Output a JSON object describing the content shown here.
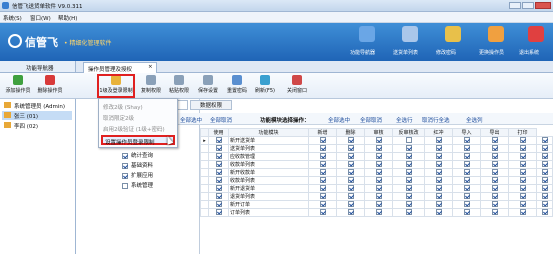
{
  "window": {
    "title": "信管飞送货单软件 V9.0.311"
  },
  "menu": [
    "系统(S)",
    "窗口(W)",
    "帮助(H)"
  ],
  "banner": {
    "logo": "信管飞",
    "slogan": "• 精细化管理软件",
    "buttons": [
      {
        "label": "功能导航器",
        "icon": "navigator-icon",
        "color": "#6aa6e6"
      },
      {
        "label": "送货单列表",
        "icon": "list-icon",
        "color": "#a9c6ea"
      },
      {
        "label": "修改密码",
        "icon": "lock-icon",
        "color": "#e8c04a"
      },
      {
        "label": "更换操作员",
        "icon": "user-icon",
        "color": "#f0a040"
      },
      {
        "label": "退出系统",
        "icon": "power-icon",
        "color": "#e04040"
      }
    ]
  },
  "nav": {
    "title": "功能导航器"
  },
  "tabs": [
    {
      "label": "操作员管理及授权",
      "close": "×"
    }
  ],
  "toolbar": [
    {
      "label": "添加操作员",
      "color": "#3fa03f"
    },
    {
      "label": "删除操作员",
      "color": "#d83a3a"
    },
    {
      "label": "1级及登录限制",
      "color": "#e8b23a"
    },
    {
      "label": "复制权限",
      "color": "#8aa0b8"
    },
    {
      "label": "粘贴权限",
      "color": "#8aa0b8"
    },
    {
      "label": "保存设置",
      "color": "#8aa0b8"
    },
    {
      "label": "重置密码",
      "color": "#5a8fd0"
    },
    {
      "label": "刷新(F5)",
      "color": "#3aa0d0"
    },
    {
      "label": "关闭窗口",
      "color": "#d04848"
    }
  ],
  "dropdown": {
    "items": [
      "修改2级 (Shay)",
      "取消限定2级",
      "启用2级验证 (1级+密码)",
      "设置操作员登录限制"
    ],
    "selected": 3
  },
  "users": [
    {
      "name": "系统管理员 (Admin)",
      "selected": false
    },
    {
      "name": "张三 (01)",
      "selected": true
    },
    {
      "name": "李四 (02)",
      "selected": false
    }
  ],
  "subtabs": [
    "操作权限",
    "数据权限"
  ],
  "modules": [
    {
      "label": "统计查询",
      "checked": true
    },
    {
      "label": "基础资料",
      "checked": true
    },
    {
      "label": "扩展应用",
      "checked": true
    },
    {
      "label": "系统管理",
      "checked": false
    }
  ],
  "perm_bar": {
    "select_all_left": "全部选中",
    "clear_all_left": "全部取消",
    "title": "功能模块选择操作：",
    "select_all": "全部选中",
    "clear_all": "全部取消",
    "select_row": "全选行",
    "clear_row": "取消行全选",
    "select_col": "全选列"
  },
  "grid": {
    "columns": [
      "使用",
      "功能模块",
      "新增",
      "删除",
      "审核",
      "反审核改",
      "红冲",
      "导入",
      "导出",
      "打印"
    ],
    "rows": [
      {
        "name": "新开送货单",
        "cells": [
          1,
          1,
          1,
          1,
          0,
          1,
          1,
          1,
          1,
          1
        ]
      },
      {
        "name": "送货单列表",
        "cells": [
          1,
          1,
          1,
          1,
          1,
          1,
          1,
          1,
          1,
          1
        ]
      },
      {
        "name": "应收款管理",
        "cells": [
          1,
          1,
          1,
          1,
          1,
          1,
          1,
          1,
          1,
          1
        ]
      },
      {
        "name": "收款单列表",
        "cells": [
          1,
          1,
          1,
          1,
          1,
          1,
          1,
          1,
          1,
          1
        ]
      },
      {
        "name": "新开收款单",
        "cells": [
          1,
          1,
          1,
          1,
          1,
          1,
          1,
          1,
          1,
          1
        ]
      },
      {
        "name": "收款单列表",
        "cells": [
          1,
          1,
          1,
          1,
          1,
          1,
          1,
          1,
          1,
          1
        ]
      },
      {
        "name": "新开退货单",
        "cells": [
          1,
          1,
          1,
          1,
          1,
          1,
          1,
          1,
          1,
          1
        ]
      },
      {
        "name": "退货单列表",
        "cells": [
          1,
          1,
          1,
          1,
          1,
          1,
          1,
          1,
          1,
          1
        ]
      },
      {
        "name": "新开订单",
        "cells": [
          1,
          1,
          1,
          1,
          1,
          1,
          1,
          1,
          1,
          1
        ]
      },
      {
        "name": "订单列表",
        "cells": [
          1,
          1,
          1,
          1,
          1,
          1,
          1,
          1,
          1,
          1
        ]
      }
    ]
  }
}
